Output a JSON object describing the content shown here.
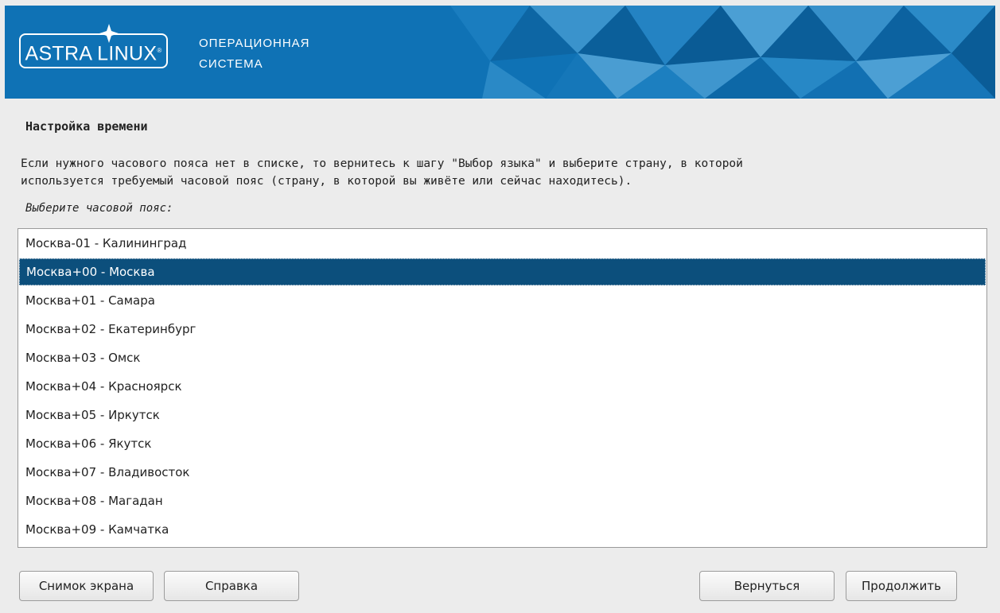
{
  "banner": {
    "logo_text": "ASTRA LINUX",
    "logo_mark": "®",
    "subtitle_line1": "ОПЕРАЦИОННАЯ",
    "subtitle_line2": "СИСТЕМА",
    "colors": {
      "background": "#0f72b5",
      "facet_light": "#3d8fc8",
      "facet_dark": "#0b5f9a"
    }
  },
  "page": {
    "title": "Настройка времени",
    "description_line1": "Если нужного часового пояса нет в списке, то вернитесь к шагу \"Выбор языка\" и выберите страну, в которой",
    "description_line2": "используется требуемый часовой пояс (страну, в которой вы живёте или сейчас находитесь).",
    "prompt": "Выберите часовой пояс:"
  },
  "timezones": {
    "selected_index": 1,
    "selected_color": "#0c4f7c",
    "items": [
      "Москва-01 - Калининград",
      "Москва+00 - Москва",
      "Москва+01 - Самара",
      "Москва+02 - Екатеринбург",
      "Москва+03 - Омск",
      "Москва+04 - Красноярск",
      "Москва+05 - Иркутск",
      "Москва+06 - Якутск",
      "Москва+07 - Владивосток",
      "Москва+08 - Магадан",
      "Москва+09 - Камчатка"
    ]
  },
  "buttons": {
    "screenshot": "Снимок экрана",
    "help": "Справка",
    "back": "Вернуться",
    "continue": "Продолжить"
  }
}
